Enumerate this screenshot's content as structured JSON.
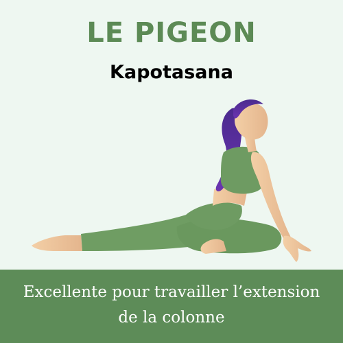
{
  "title": "LE PIGEON",
  "subtitle": "Kapotasana",
  "description_lines": [
    "Excellente pour travailler l’extension",
    "de la colonne"
  ],
  "illustration": "pigeon-pose-figure",
  "colors": {
    "background": "#eef7f1",
    "accent_green": "#5d8c58",
    "title_green": "#5c8a55",
    "hair": "#5a2e9a",
    "skin": "#e9c09a",
    "clothing": "#6e9b62"
  }
}
